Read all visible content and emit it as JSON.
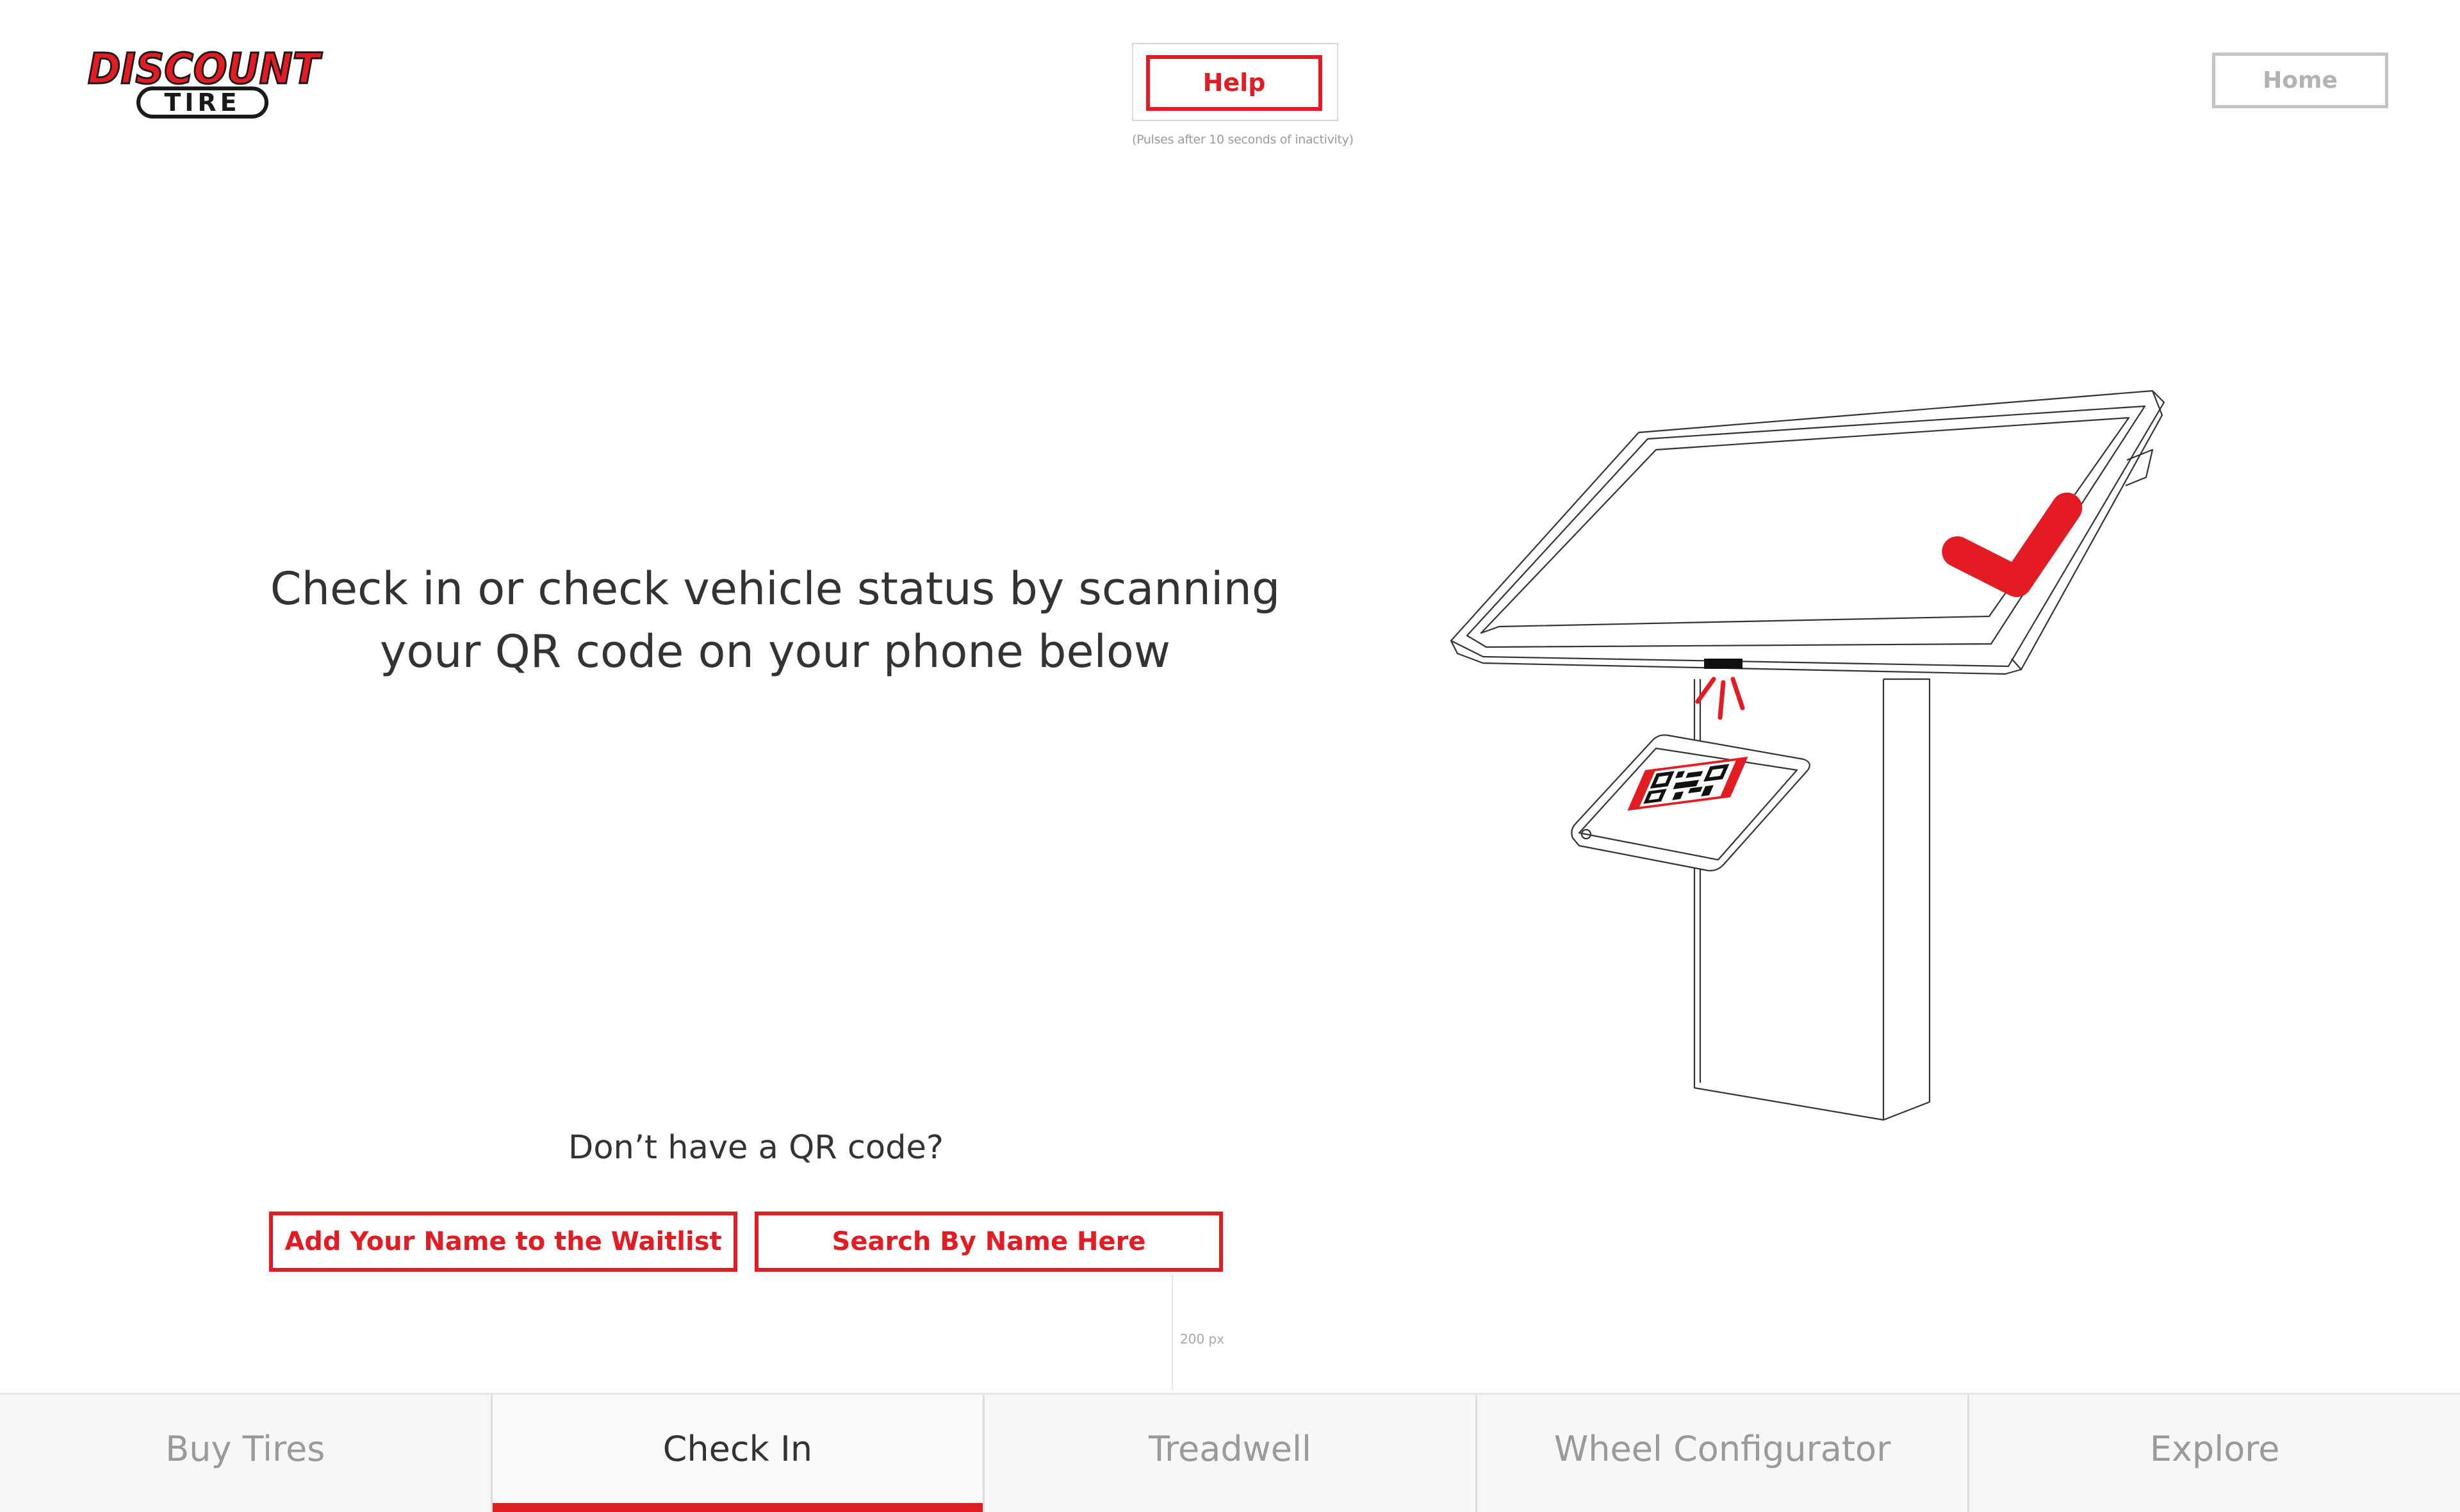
{
  "brand": {
    "logo_top": "DISCOUNT",
    "logo_bottom": "TIRE",
    "accent_color": "#e31b23"
  },
  "header": {
    "help_label": "Help",
    "help_note": "(Pulses after 10 seconds of inactivity)",
    "home_label": "Home"
  },
  "main": {
    "headline_line1": "Check in or check vehicle status by scanning",
    "headline_line2": "your QR code on your phone below",
    "no_qr_prompt": "Don’t have a QR code?",
    "waitlist_button": "Add Your Name to the Waitlist",
    "search_button": "Search By Name Here",
    "measure_label": "200 px"
  },
  "illustration": {
    "icons": [
      "kiosk-illustration",
      "checkmark-icon",
      "phone-icon",
      "qr-code-icon",
      "scanner-icon"
    ]
  },
  "tabs": [
    {
      "label": "Buy Tires",
      "active": false
    },
    {
      "label": "Check In",
      "active": true
    },
    {
      "label": "Treadwell",
      "active": false
    },
    {
      "label": "Wheel Configurator",
      "active": false
    },
    {
      "label": "Explore",
      "active": false
    }
  ]
}
